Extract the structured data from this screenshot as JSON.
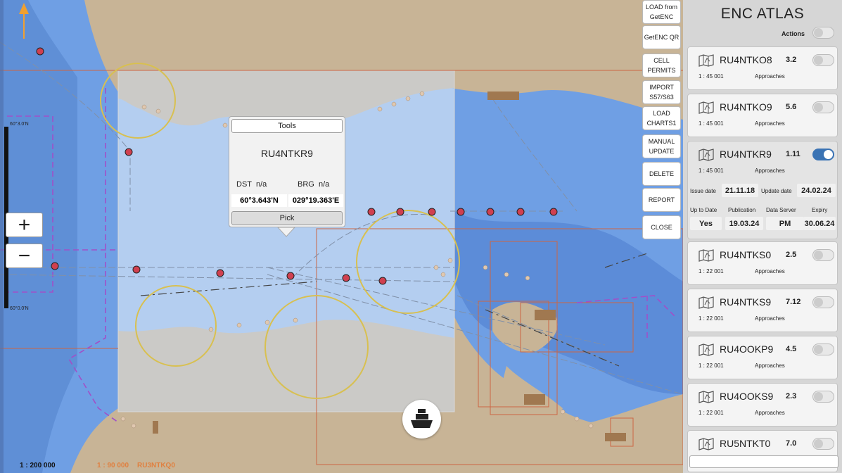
{
  "map": {
    "scale_left": "1 : 200 000",
    "scale_mid": "1 : 90 000",
    "chart_label": "RU3NTKQ0",
    "lat_top": "60°3.0'N",
    "lat_bottom": "60°0.0'N",
    "colors": {
      "land": "#c8b496",
      "deep_water": "#6f9fe4",
      "shallow_water": "#95bdf0",
      "highlight": "rgba(205,220,240,0.72)",
      "boundary": "#cc6644",
      "restricted": "#a050c8",
      "circle": "#d8c050"
    }
  },
  "tools_popup": {
    "title_button": "Tools",
    "cell_name": "RU4NTKR9",
    "dst_label": "DST",
    "dst_value": "n/a",
    "brg_label": "BRG",
    "brg_value": "n/a",
    "lat": "60°3.643'N",
    "lon": "029°19.363'E",
    "pick_button": "Pick"
  },
  "zoom": {
    "in_icon": "plus-icon",
    "out_icon": "minus-icon",
    "in_label": "+",
    "out_label": "−"
  },
  "side_buttons": [
    {
      "label": "LOAD from\nGetENC"
    },
    {
      "label": "GetENC QR"
    },
    {
      "label": "CELL\nPERMITS"
    },
    {
      "label": "IMPORT\nS57/S63"
    },
    {
      "label": "LOAD\nCHARTS1"
    },
    {
      "label": "MANUAL\nUPDATE"
    },
    {
      "label": "DELETE"
    },
    {
      "label": "REPORT"
    },
    {
      "label": "CLOSE"
    }
  ],
  "ship_icon": "ship-icon",
  "atlas": {
    "title": "ENC ATLAS",
    "actions_label": "Actions",
    "accent": "#3a73b4",
    "cells": [
      {
        "name": "RU4NTKO8",
        "version": "3.2",
        "scale": "1 : 45 001",
        "usage": "Approaches",
        "on": false
      },
      {
        "name": "RU4NTKO9",
        "version": "5.6",
        "scale": "1 : 45 001",
        "usage": "Approaches",
        "on": false
      },
      {
        "name": "RU4NTKR9",
        "version": "1.11",
        "scale": "1 : 45 001",
        "usage": "Approaches",
        "on": true,
        "details": {
          "issue_label": "Issue date",
          "issue_value": "21.11.18",
          "update_label": "Update date",
          "update_value": "24.02.24",
          "uptodate_label": "Up to Date",
          "uptodate_value": "Yes",
          "publication_label": "Publication",
          "publication_value": "19.03.24",
          "dataserver_label": "Data Server",
          "dataserver_value": "PM",
          "expiry_label": "Expiry",
          "expiry_value": "30.06.24"
        }
      },
      {
        "name": "RU4NTKS0",
        "version": "2.5",
        "scale": "1 : 22 001",
        "usage": "Approaches",
        "on": false
      },
      {
        "name": "RU4NTKS9",
        "version": "7.12",
        "scale": "1 : 22 001",
        "usage": "Approaches",
        "on": false
      },
      {
        "name": "RU4OOKP9",
        "version": "4.5",
        "scale": "1 : 22 001",
        "usage": "Approaches",
        "on": false
      },
      {
        "name": "RU4OOKS9",
        "version": "2.3",
        "scale": "1 : 22 001",
        "usage": "Approaches",
        "on": false
      },
      {
        "name": "RU5NTKT0",
        "version": "7.0",
        "scale": "",
        "usage": "",
        "on": false
      }
    ]
  }
}
